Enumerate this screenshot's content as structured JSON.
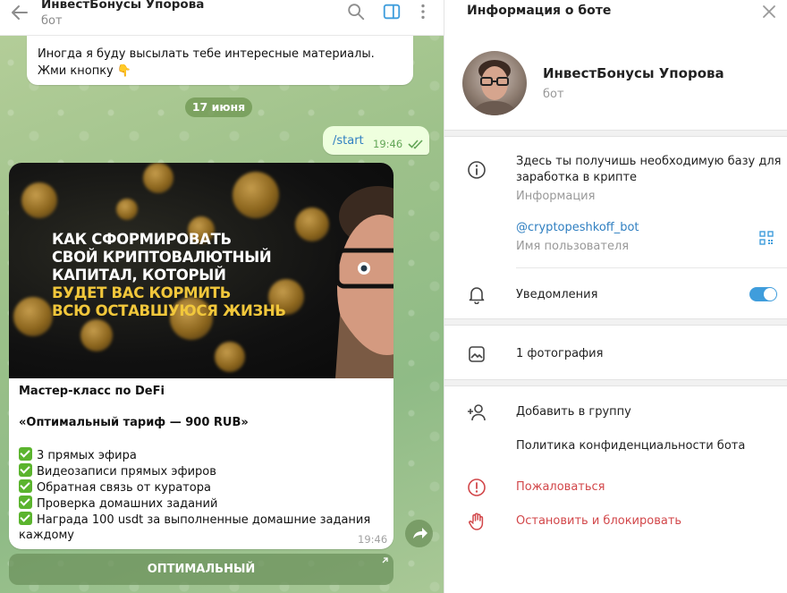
{
  "chat": {
    "title": "ИнвестБонусы Упорова",
    "subtitle": "бот",
    "top_message": "Иногда я буду высылать тебе интересные материалы. Жми кнопку 👇",
    "date_label": "17 июня",
    "start_message": {
      "text": "/start",
      "time": "19:46"
    },
    "post": {
      "banner_lines": [
        "КАК СФОРМИРОВАТЬ",
        "СВОЙ КРИПТОВАЛЮТНЫЙ",
        "КАПИТАЛ, КОТОРЫЙ",
        "БУДЕТ ВАС КОРМИТЬ",
        "ВСЮ ОСТАВШУЮСЯ ЖИЗНЬ"
      ],
      "heading": "Мастер-класс по DeFi",
      "tariff": "«Оптимальный тариф — 900 RUB»",
      "features": [
        "3 прямых эфира",
        "Видеозаписи прямых эфиров",
        "Обратная связь от куратора",
        "Проверка домашних заданий",
        "Награда 100 usdt за выполненные домашние задания"
      ],
      "features_tail": "каждому",
      "time": "19:46"
    },
    "keyboard_button": "ОПТИМАЛЬНЫЙ"
  },
  "info": {
    "panel_title": "Информация о боте",
    "bot_name": "ИнвестБонусы Упорова",
    "bot_type": "бот",
    "description_line1": "Здесь ты получишь необходимую базу для",
    "description_line2": "заработка в крипте",
    "description_caption": "Информация",
    "username": "@cryptopeshkoff_bot",
    "username_caption": "Имя пользователя",
    "notifications": "Уведомления",
    "notifications_on": true,
    "photos": "1 фотография",
    "add_to_group": "Добавить в группу",
    "privacy_policy": "Политика конфиденциальности бота",
    "report": "Пожаловаться",
    "stop_block": "Остановить и блокировать"
  },
  "colors": {
    "accent": "#3f9ddc",
    "danger": "#d2474a",
    "outgoing_bubble": "#eeffde",
    "check_green": "#5bb42e"
  }
}
